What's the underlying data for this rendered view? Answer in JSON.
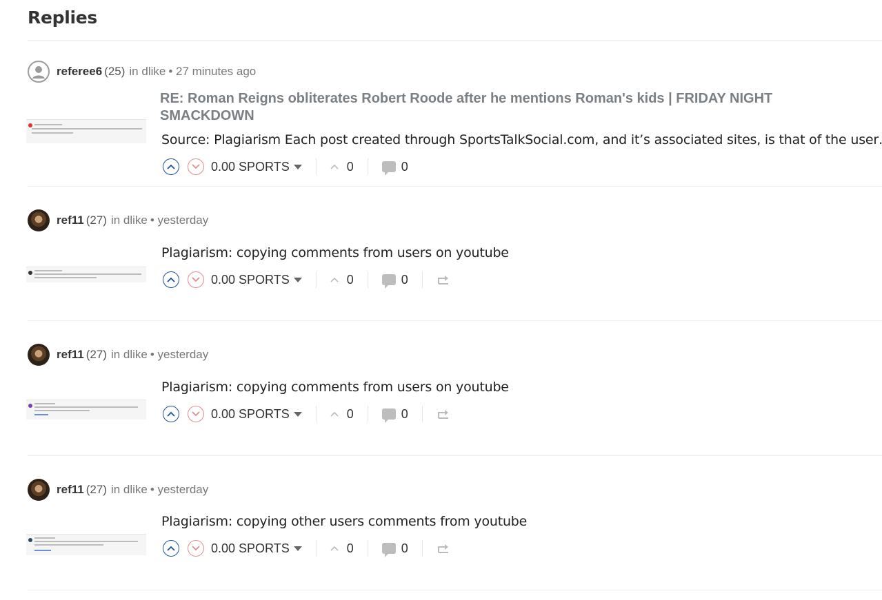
{
  "page": {
    "title": "Replies"
  },
  "replies": [
    {
      "author": "referee6",
      "rep": "(25)",
      "community": "in dlike",
      "time": "• 27 minutes ago",
      "title": "RE: Roman Reigns obliterates Robert Roode after he mentions Roman's kids | FRIDAY NIGHT SMACKDOWN",
      "body": "Source: Plagiarism Each post created through SportsTalkSocial.com, and it’s associated sites, is that of the user…",
      "payout": "0.00 SPORTS",
      "votes": "0",
      "comments": "0"
    },
    {
      "author": "ref11",
      "rep": "(27)",
      "community": "in dlike",
      "time": "• yesterday",
      "body": "Plagiarism: copying comments from users on youtube",
      "payout": "0.00 SPORTS",
      "votes": "0",
      "comments": "0"
    },
    {
      "author": "ref11",
      "rep": "(27)",
      "community": "in dlike",
      "time": "• yesterday",
      "body": "Plagiarism: copying comments from users on youtube",
      "payout": "0.00 SPORTS",
      "votes": "0",
      "comments": "0"
    },
    {
      "author": "ref11",
      "rep": "(27)",
      "community": "in dlike",
      "time": "• yesterday",
      "body": "Plagiarism: copying other users comments from youtube",
      "payout": "0.00 SPORTS",
      "votes": "0",
      "comments": "0"
    }
  ],
  "colors": {
    "upvote": "#1a5099",
    "downvote": "#e38b8b",
    "muted": "#777777"
  },
  "icons": [
    "user-icon",
    "upvote-icon",
    "downvote-icon",
    "caret-down-icon",
    "chevron-up-icon",
    "comment-icon",
    "reblog-icon"
  ]
}
